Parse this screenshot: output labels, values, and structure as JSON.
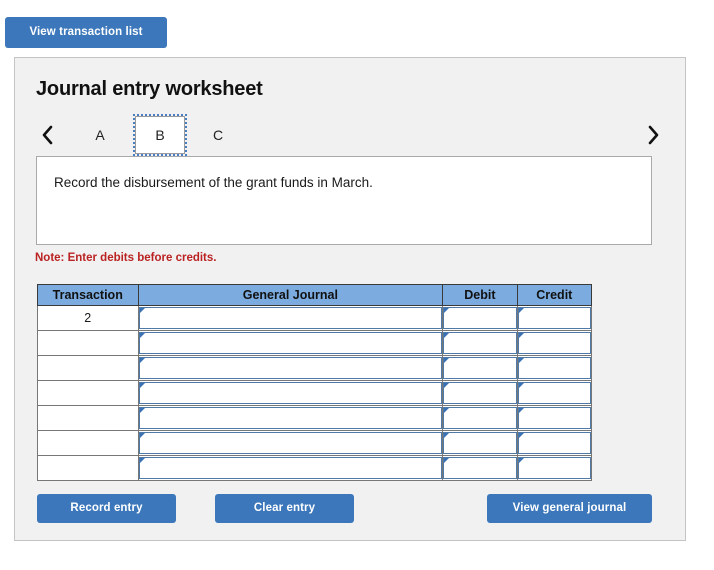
{
  "top_bar": {
    "view_transaction_list_label": "View transaction list"
  },
  "panel": {
    "title": "Journal entry worksheet",
    "tabs": {
      "prev_icon": "chevron-left-icon",
      "next_icon": "chevron-right-icon",
      "items": [
        {
          "label": "A",
          "selected": false
        },
        {
          "label": "B",
          "selected": true
        },
        {
          "label": "C",
          "selected": false
        }
      ]
    },
    "instruction": "Record the disbursement of the grant funds in March.",
    "note": "Note: Enter debits before credits.",
    "table": {
      "headers": [
        "Transaction",
        "General Journal",
        "Debit",
        "Credit"
      ],
      "rows": [
        {
          "transaction": "2",
          "journal": "",
          "debit": "",
          "credit": ""
        },
        {
          "transaction": "",
          "journal": "",
          "debit": "",
          "credit": ""
        },
        {
          "transaction": "",
          "journal": "",
          "debit": "",
          "credit": ""
        },
        {
          "transaction": "",
          "journal": "",
          "debit": "",
          "credit": ""
        },
        {
          "transaction": "",
          "journal": "",
          "debit": "",
          "credit": ""
        },
        {
          "transaction": "",
          "journal": "",
          "debit": "",
          "credit": ""
        },
        {
          "transaction": "",
          "journal": "",
          "debit": "",
          "credit": ""
        }
      ]
    },
    "actions": {
      "record_entry_label": "Record entry",
      "clear_entry_label": "Clear entry",
      "view_general_journal_label": "View general journal"
    }
  },
  "colors": {
    "button_blue": "#3b77ba",
    "table_header_blue": "#7babdf",
    "note_red": "#bb2222",
    "panel_gray": "#f1f1f1",
    "input_border_blue": "#4f7aa8",
    "focus_outline_blue": "#4a7fc1"
  }
}
